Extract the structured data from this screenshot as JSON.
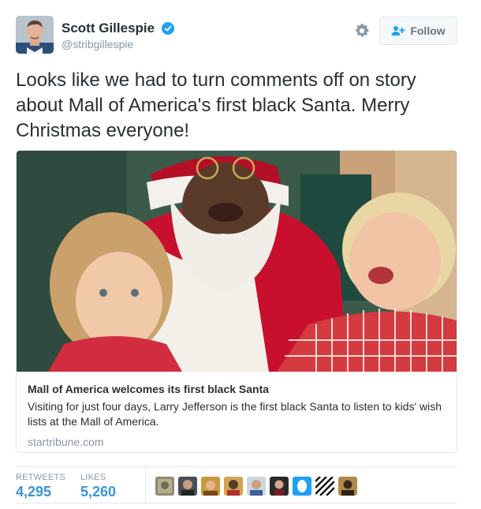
{
  "author": {
    "name": "Scott Gillespie",
    "handle": "@stribgillespie",
    "verified_icon": "verified-badge-icon"
  },
  "actions": {
    "follow_label": "Follow",
    "settings_icon": "gear-icon"
  },
  "tweet": {
    "text": "Looks like we had to turn comments off on story about Mall of America's first black Santa. Merry Christmas everyone!"
  },
  "card": {
    "title": "Mall of America welcomes its first black Santa",
    "description": "Visiting for just four days, Larry Jefferson is the first black Santa to listen to kids' wish lists at the Mall of America.",
    "domain": "startribune.com"
  },
  "stats": {
    "retweets_label": "RETWEETS",
    "retweets_value": "4,295",
    "likes_label": "LIKES",
    "likes_value": "5,260"
  },
  "colors": {
    "accent": "#3b94d9",
    "verified": "#1da1f2",
    "muted": "#8899a6",
    "border": "#e1e8ed"
  }
}
